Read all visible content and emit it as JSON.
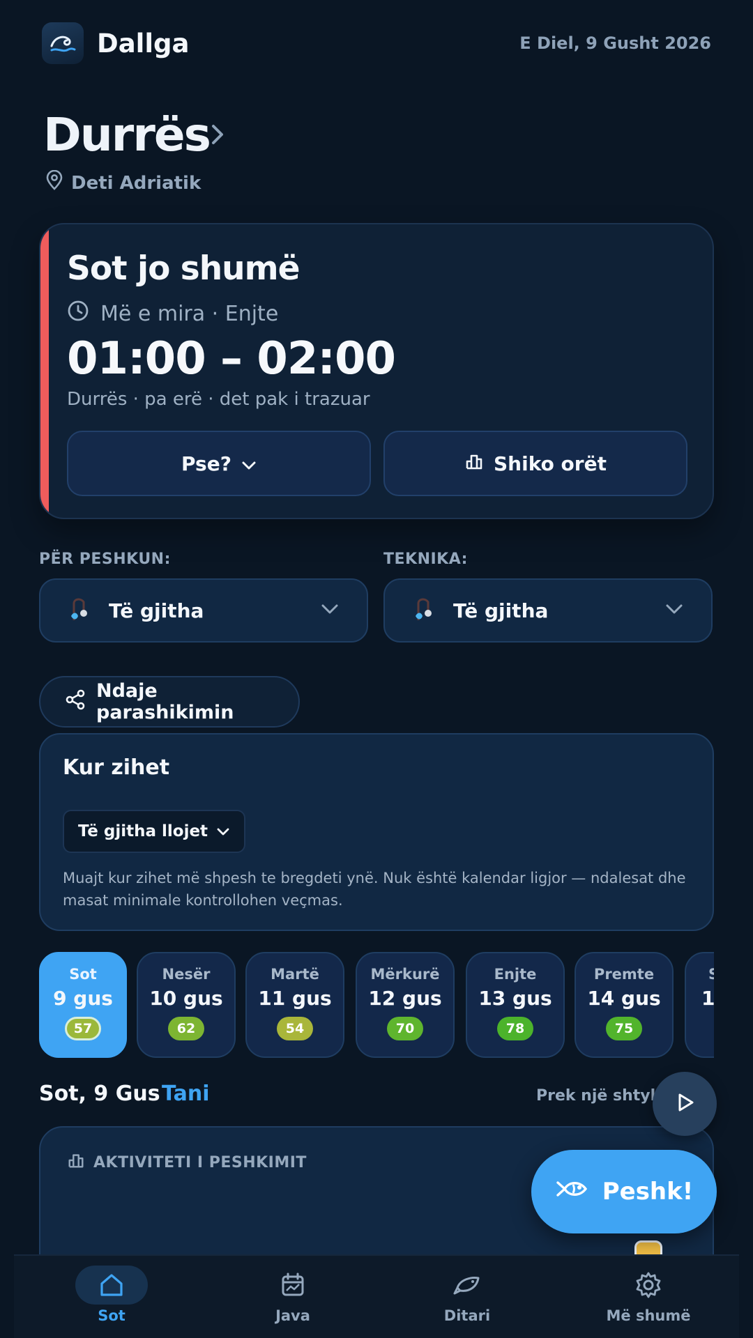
{
  "app": {
    "name": "Dallga",
    "date": "E Diel, 9 Gusht 2026"
  },
  "location": {
    "title": "Durrës",
    "subtitle": "Deti Adriatik"
  },
  "forecast": {
    "title": "Sot jo shumë",
    "best_label": "Më e mira · Enjte",
    "time_range": "01:00 – 02:00",
    "conditions": "Durrës · pa erë · det pak i trazuar",
    "why_label": "Pse?",
    "hours_label": "Shiko orët",
    "accent_color": "#ef5c5c"
  },
  "filters": {
    "fish_label": "PËR PESHKUN:",
    "fish_value": "Të gjitha",
    "technique_label": "TEKNIKA:",
    "technique_value": "Të gjitha"
  },
  "share_label": "Ndaje parashikimin",
  "kur_zihet": {
    "title": "Kur zihet",
    "dropdown": "Të gjitha llojet",
    "description": "Muajt kur zihet më shpesh te bregdeti ynë. Nuk është kalendar ligjor — ndalesat dhe masat minimale kontrollohen veçmas."
  },
  "days": [
    {
      "name": "Sot",
      "date": "9 gus",
      "score": "57",
      "color": "#9bb83a",
      "active": true
    },
    {
      "name": "Nesër",
      "date": "10 gus",
      "score": "62",
      "color": "#7db532"
    },
    {
      "name": "Martë",
      "date": "11 gus",
      "score": "54",
      "color": "#a9b63a"
    },
    {
      "name": "Mërkurë",
      "date": "12 gus",
      "score": "70",
      "color": "#5fb52e"
    },
    {
      "name": "Enjte",
      "date": "13 gus",
      "score": "78",
      "color": "#4cb32b"
    },
    {
      "name": "Premte",
      "date": "14 gus",
      "score": "75",
      "color": "#52b42c"
    },
    {
      "name": "S",
      "date": "1",
      "score": "",
      "color": "#52b42c"
    }
  ],
  "today": {
    "label": "Sot, 9 Gus",
    "now": "Tani",
    "hint": "Prek një shtyllë"
  },
  "activity": {
    "title": "AKTIVITETI I PESHKIMIT"
  },
  "fab": {
    "label": "Peshk!"
  },
  "nav": [
    {
      "label": "Sot",
      "icon": "home-icon",
      "active": true
    },
    {
      "label": "Java",
      "icon": "calendar-icon"
    },
    {
      "label": "Ditari",
      "icon": "fish-icon"
    },
    {
      "label": "Më shumë",
      "icon": "gear-icon"
    }
  ],
  "colors": {
    "background": "#0a1624",
    "accent": "#3fa4f3",
    "card": "#112843"
  }
}
